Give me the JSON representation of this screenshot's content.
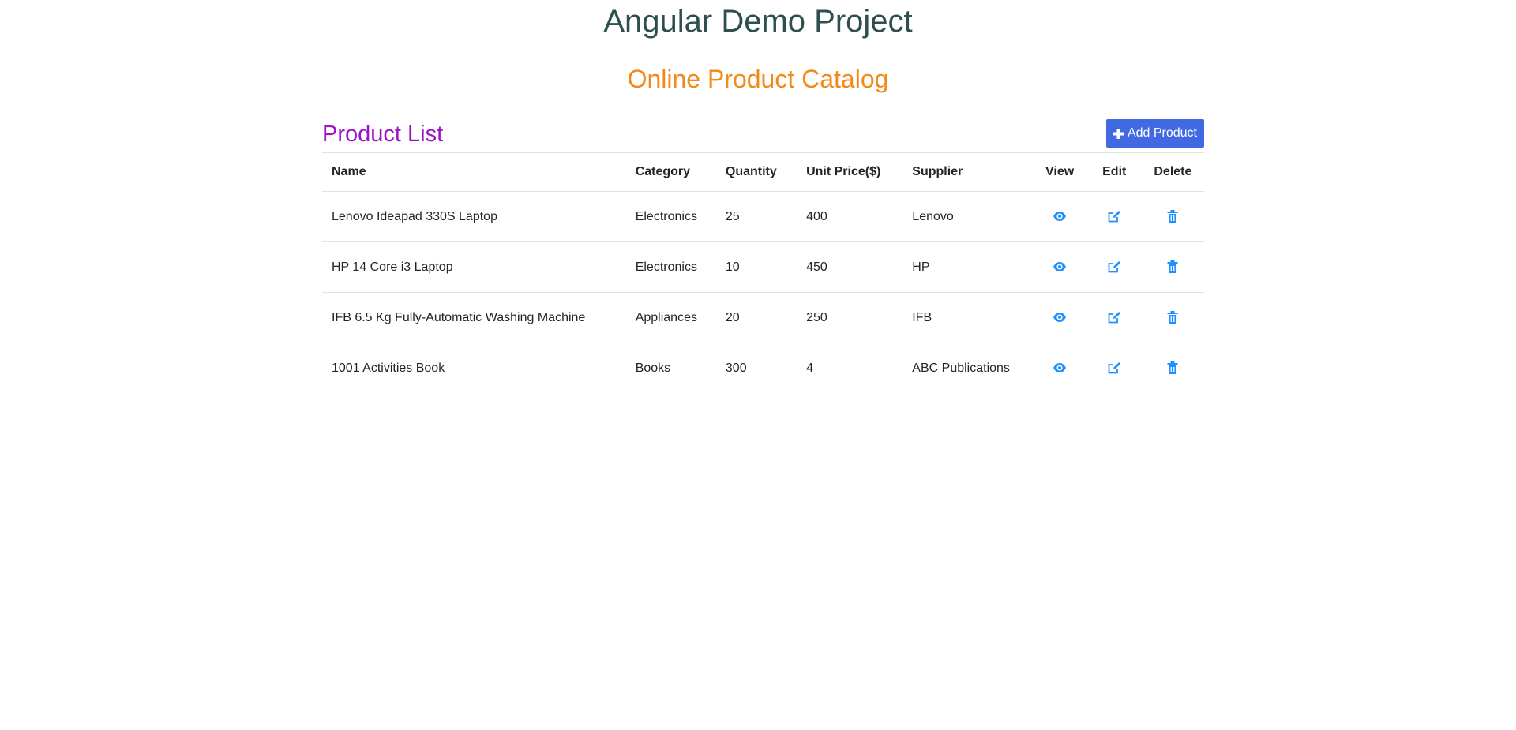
{
  "app": {
    "title": "Angular Demo Project",
    "subtitle": "Online Product Catalog"
  },
  "product_list": {
    "title": "Product List",
    "add_button_label": "Add Product",
    "add_button_icon": "plus-icon",
    "columns": [
      "Name",
      "Category",
      "Quantity",
      "Unit Price($)",
      "Supplier",
      "View",
      "Edit",
      "Delete"
    ],
    "rows": [
      {
        "name": "Lenovo Ideapad 330S Laptop",
        "category": "Electronics",
        "quantity": "25",
        "unit_price": "400",
        "supplier": "Lenovo"
      },
      {
        "name": "HP 14 Core i3 Laptop",
        "category": "Electronics",
        "quantity": "10",
        "unit_price": "450",
        "supplier": "HP"
      },
      {
        "name": "IFB 6.5 Kg Fully-Automatic Washing Machine",
        "category": "Appliances",
        "quantity": "20",
        "unit_price": "250",
        "supplier": "IFB"
      },
      {
        "name": "1001 Activities Book",
        "category": "Books",
        "quantity": "300",
        "unit_price": "4",
        "supplier": "ABC Publications"
      }
    ],
    "row_action_icons": [
      "eye-icon",
      "edit-icon",
      "trash-icon"
    ]
  },
  "colors": {
    "title": "#2f4f4f",
    "subtitle": "#f28a1a",
    "list_title": "#9c14c6",
    "button_bg": "#4169e1",
    "icon": "#1e90ff",
    "border": "#dee2e6"
  }
}
